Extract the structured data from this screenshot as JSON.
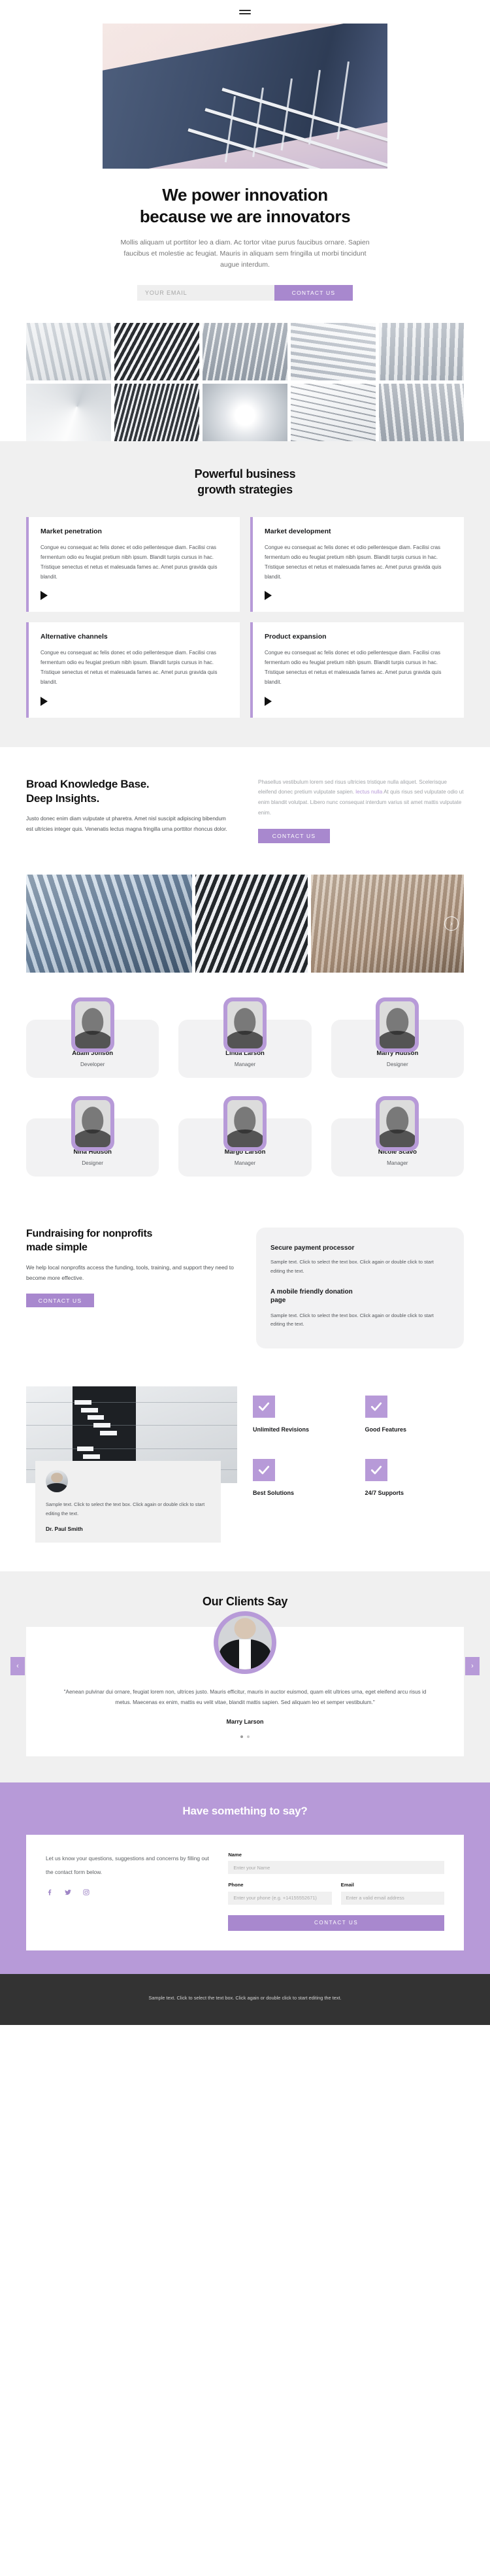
{
  "header": {
    "menu_icon": "hamburger-icon"
  },
  "hero": {
    "title_line1": "We power innovation",
    "title_line2": "because we are innovators",
    "subtitle": "Mollis aliquam ut porttitor leo a diam. Ac tortor vitae purus faucibus ornare. Sapien faucibus et molestie ac feugiat. Mauris in aliquam sem fringilla ut morbi tincidunt augue interdum.",
    "email_placeholder": "YOUR EMAIL",
    "cta_label": "CONTACT US"
  },
  "gallery": {
    "items": [
      "architecture-facade-photo",
      "striped-building-photo",
      "glass-tower-photo",
      "white-geometry-photo",
      "concrete-lines-photo",
      "staircase-photo",
      "dark-louvers-photo",
      "spiral-stair-photo",
      "interior-corridor-photo",
      "modern-tower-photo"
    ]
  },
  "strategies": {
    "title_line1": "Powerful business",
    "title_line2": "growth strategies",
    "body_text": "Congue eu consequat ac felis donec et odio pellentesque diam. Facilisi cras fermentum odio eu feugiat pretium nibh ipsum. Blandit turpis cursus in hac. Tristique senectus et netus et malesuada fames ac. Amet purus gravida quis blandit.",
    "cards": [
      {
        "title": "Market penetration"
      },
      {
        "title": "Market development"
      },
      {
        "title": "Alternative channels"
      },
      {
        "title": "Product expansion"
      }
    ]
  },
  "knowledge": {
    "title_line1": "Broad Knowledge Base.",
    "title_line2": "Deep Insights.",
    "body": "Justo donec enim diam vulputate ut pharetra. Amet nisl suscipit adipiscing bibendum est ultricies integer quis. Venenatis lectus magna fringilla urna porttitor rhoncus dolor.",
    "right_part1": "Phasellus vestibulum lorem sed risus ultricies tristique nulla aliquet. Scelerisque eleifend donec pretium vulputate sapien. ",
    "right_highlight": "lectus nulla",
    "right_part2": " At quis risus sed vulputate odio ut enim blandit volutpat. Libero nunc consequat interdum varius sit amet mattis vulputate enim.",
    "cta_label": "CONTACT US"
  },
  "wide_gallery": {
    "items": [
      "blue-glass-skyscraper-photo",
      "dark-striped-facade-photo",
      "woman-on-phone-laptop-photo"
    ],
    "next_icon": "chevron-right-icon"
  },
  "team": {
    "members": [
      {
        "name": "Adam Jonson",
        "role": "Developer"
      },
      {
        "name": "Linda Larson",
        "role": "Manager"
      },
      {
        "name": "Marry Hudson",
        "role": "Designer"
      },
      {
        "name": "Nina Hudson",
        "role": "Designer"
      },
      {
        "name": "Margo Larson",
        "role": "Manager"
      },
      {
        "name": "Nicole Scavo",
        "role": "Manager"
      }
    ]
  },
  "fundraising": {
    "title_line1": "Fundraising for nonprofits",
    "title_line2": "made simple",
    "lead": "We help local nonprofits access the funding, tools, training, and support they need to become more effective.",
    "cta_label": "CONTACT US",
    "card": {
      "heading1": "Secure payment processor",
      "text1": "Sample text. Click to select the text box. Click again or double click to start editing the text.",
      "heading2_line1": "A mobile friendly donation",
      "heading2_line2": "page",
      "text2": "Sample text. Click to select the text box. Click again or double click to start editing the text."
    }
  },
  "features": {
    "quote": {
      "text": "Sample text. Click to select the text box. Click again or double click to start editing the text.",
      "author": "Dr. Paul Smith",
      "avatar": "portrait-avatar"
    },
    "items": [
      {
        "label": "Unlimited Revisions",
        "icon": "check-icon"
      },
      {
        "label": "Good Features",
        "icon": "check-icon"
      },
      {
        "label": "Best Solutions",
        "icon": "check-icon"
      },
      {
        "label": "24/7 Supports",
        "icon": "check-icon"
      }
    ]
  },
  "testimonials": {
    "title": "Our Clients Say",
    "prev_icon": "chevron-left-icon",
    "next_icon": "chevron-right-icon",
    "quote": "\"Aenean pulvinar dui ornare, feugiat lorem non, ultrices justo. Mauris efficitur, mauris in auctor euismod, quam elit ultrices urna, eget eleifend arcu risus id metus. Maecenas ex enim, mattis eu velit vitae, blandit mattis sapien. Sed aliquam leo et semper vestibulum.\"",
    "author": "Marry Larson",
    "dots": 2
  },
  "contact": {
    "heading": "Have something to say?",
    "intro": "Let us know your questions, suggestions and concerns by filling out the contact form below.",
    "socials": [
      "facebook-icon",
      "twitter-icon",
      "instagram-icon"
    ],
    "name_label": "Name",
    "name_placeholder": "Enter your Name",
    "phone_label": "Phone",
    "phone_placeholder": "Enter your phone (e.g. +14155552671)",
    "email_label": "Email",
    "email_placeholder": "Enter a valid email address",
    "submit_label": "CONTACT US"
  },
  "footer": {
    "text": "Sample text. Click to select the text box. Click again or double click to start editing the text."
  },
  "colors": {
    "accent": "#b79ad8",
    "accent_soft": "#a888ce",
    "grey_section": "#f0f0f0",
    "footer_bg": "#333333"
  }
}
